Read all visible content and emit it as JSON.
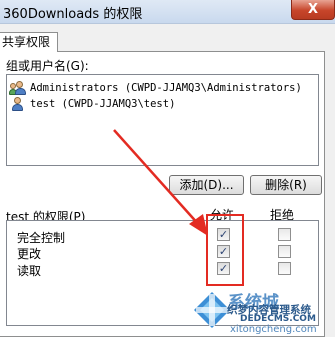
{
  "window": {
    "title": "360Downloads 的权限",
    "close_glyph": "X"
  },
  "tabs": [
    {
      "label": "共享权限"
    }
  ],
  "group_section": {
    "label": "组或用户名(G):",
    "users": [
      {
        "name": "Administrators (CWPD-JJAMQ3\\Administrators)",
        "icon": "user-group-icon"
      },
      {
        "name": "test (CWPD-JJAMQ3\\test)",
        "icon": "user-icon"
      }
    ]
  },
  "buttons": {
    "add": "添加(D)...",
    "remove": "删除(R)"
  },
  "permissions": {
    "header": "test 的权限(P)",
    "allow_header": "允许",
    "deny_header": "拒绝",
    "rows": [
      {
        "label": "完全控制",
        "allow": true,
        "deny": false
      },
      {
        "label": "更改",
        "allow": true,
        "deny": false
      },
      {
        "label": "读取",
        "allow": true,
        "deny": false
      }
    ]
  },
  "annotation": {
    "color": "#e32b22"
  },
  "watermark": {
    "line1": "系统城",
    "line2": "织梦内容管理系统",
    "line3": "DEDECMS.COM",
    "line4": "xitongcheng.com"
  }
}
